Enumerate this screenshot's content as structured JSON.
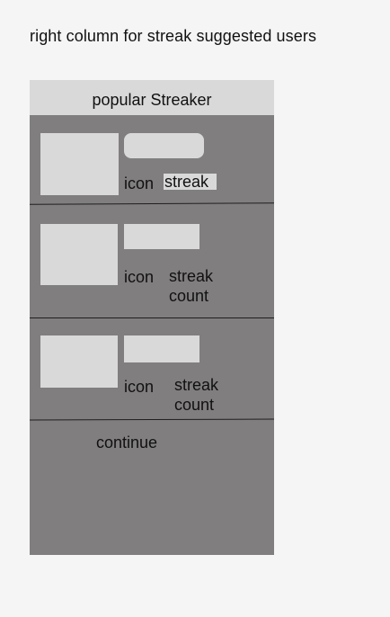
{
  "page": {
    "heading": "right column for streak suggested users"
  },
  "panel": {
    "header": "popular Streaker",
    "users": [
      {
        "icon_label": "icon",
        "streak_label": "streak"
      },
      {
        "icon_label": "icon",
        "streak_label": "streak count"
      },
      {
        "icon_label": "icon",
        "streak_label": "streak count"
      }
    ],
    "continue_label": "continue"
  },
  "colors": {
    "page_background": "#f5f5f5",
    "panel_background": "#807e7e",
    "placeholder_gray": "#d9d9d9",
    "divider": "#1f1f1f"
  }
}
